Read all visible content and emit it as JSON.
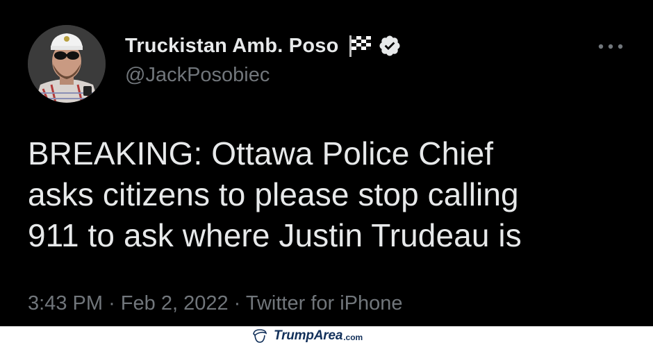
{
  "author": {
    "display_name": "Truckistan Amb. Poso",
    "handle": "@JackPosobiec",
    "avatar_icon": "user-avatar",
    "badges": [
      "checkered-flag-icon",
      "verified-badge-icon"
    ]
  },
  "tweet": {
    "lines": [
      "BREAKING: Ottawa Police Chief",
      "asks citizens to please stop calling",
      "911 to ask where Justin Trudeau is"
    ],
    "time": "3:43 PM",
    "separator": "·",
    "date": "Feb 2, 2022",
    "source": "Twitter for iPhone"
  },
  "menu": {
    "icon": "more-horizontal-icon"
  },
  "watermark": {
    "brand": "TrumpArea",
    "tld": ".com",
    "icon": "hair-logo-icon",
    "brand_color": "#12305a"
  },
  "colors": {
    "background": "#000000",
    "primary_text": "#e7e9ea",
    "secondary_text": "#71767b"
  }
}
